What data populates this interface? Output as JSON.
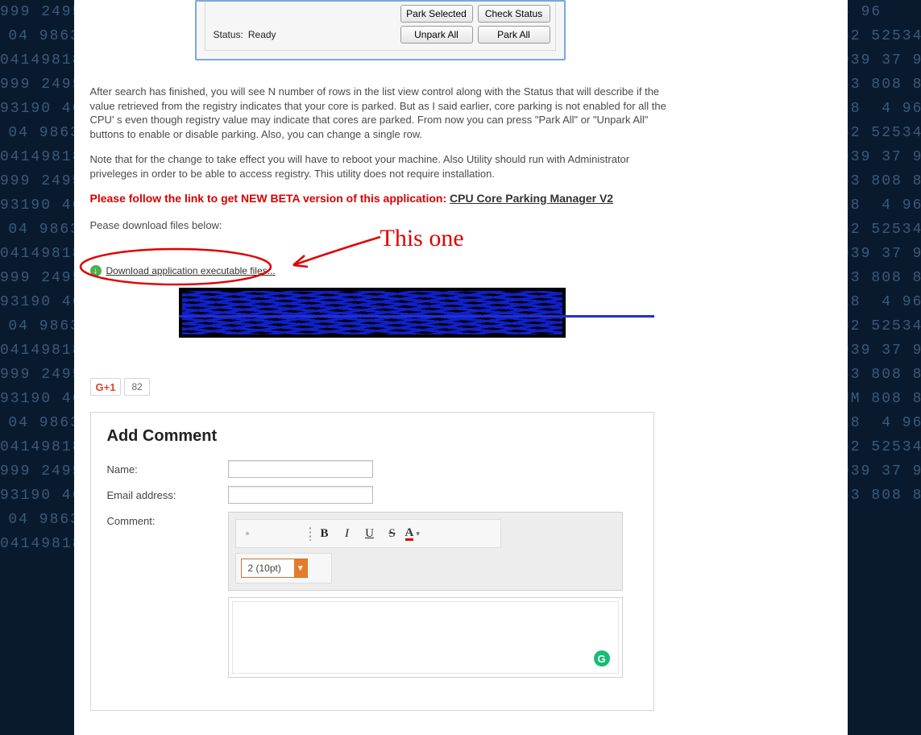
{
  "bg": {
    "left": "999 2495\n04 9863\n04149818\n999 2495\n93190 46\n04 9863\n041498186\n999 2495\n93190 46\n04 9863\n041498186\n999 2495\n93190 46\n04 9863\n041498186\n999 2495\n93190 46\n04 9863\n041498186\n999 2495\n93190 46\n04 9863\n041498186",
    "right": "4 96\n62 52534\n939 37 9\n43 808 8\n18  4 96\n62 52534\n939 37 9\n43 808 8\n18  4 96\n62 52534\n939 37 9\n43 808 8\n18  4 96\n62 52534\n939 37 9\n43 808 8\nUM 808 8\n18  4 96\n62 52534\n939 37 9\n43 808 8"
  },
  "app": {
    "buttons": {
      "park_selected": "Park Selected",
      "check_status": "Check Status",
      "unpark_all": "Unpark All",
      "park_all": "Park All"
    },
    "status_label": "Status:",
    "status_value": "Ready"
  },
  "article": {
    "p1": "After search has finished, you will see N number of rows in the list view control along with the Status that will describe if the value retrieved from the registry indicates that your core is parked. But as I said earlier, core parking is not enabled for all the CPU' s even though registry value may indicate that cores are parked. From now you can press \"Park All\" or \"Unpark All\" buttons to enable or disable parking. Also, you can change a single row.",
    "p2": "Note that for the change to take effect you will have to reboot your machine. Also Utility should run with Administrator priveleges in order to be able to access registry. This utility does not require installation.",
    "beta_prefix": "Please follow the link to get NEW BETA version of this application: ",
    "beta_link": "CPU Core Parking Manager V2",
    "download_prompt": "Pease download files below:",
    "download_link": "Download application executable files...",
    "annotation_text": "This one"
  },
  "gplus": {
    "label": "+1",
    "count": "82"
  },
  "comment": {
    "heading": "Add Comment",
    "name_label": "Name:",
    "email_label": "Email address:",
    "comment_label": "Comment:",
    "font_size": "2 (10pt)",
    "grammarly": "G"
  }
}
